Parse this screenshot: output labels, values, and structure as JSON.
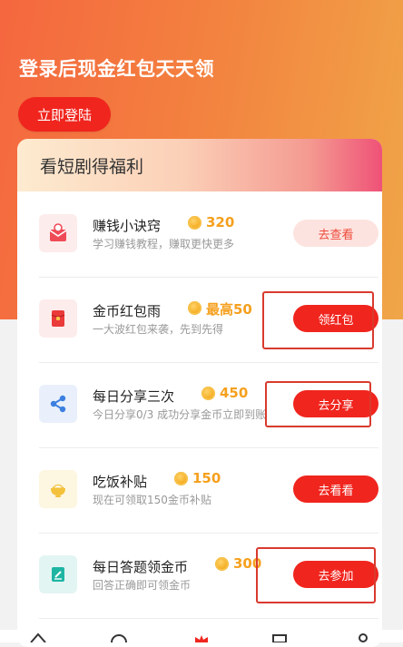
{
  "hero": {
    "title": "登录后现金红包天天领",
    "login_label": "立即登陆"
  },
  "card": {
    "title": "看短剧得福利",
    "tasks": [
      {
        "name": "赚钱小诀窍",
        "amount": "320",
        "desc": "学习赚钱教程，赚取更快更多",
        "button": "去查看",
        "icon": "envelope-icon"
      },
      {
        "name": "金币红包雨",
        "amount": "最高50",
        "desc": "一大波红包来袭，先到先得",
        "button": "领红包",
        "icon": "red-packet-icon"
      },
      {
        "name": "每日分享三次",
        "amount": "450",
        "desc": "今日分享0/3 成功分享金币立即到账",
        "button": "去分享",
        "icon": "share-icon"
      },
      {
        "name": "吃饭补贴",
        "amount": "150",
        "desc": "现在可领取150金币补贴",
        "button": "去看看",
        "icon": "rice-bowl-icon"
      },
      {
        "name": "每日答题领金币",
        "amount": "300",
        "desc": "回答正确即可领金币",
        "button": "去参加",
        "icon": "quiz-icon"
      }
    ]
  },
  "colors": {
    "accent": "#f0251e",
    "coin": "#f5a01e",
    "highlight": "#d93a2e"
  }
}
